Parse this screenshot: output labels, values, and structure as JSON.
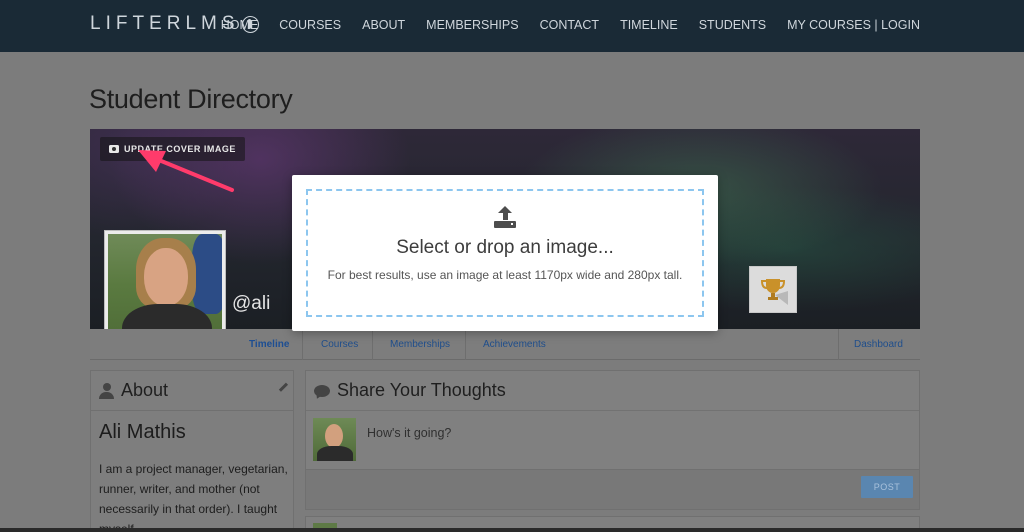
{
  "header": {
    "logo_text": "LIFTERLMS",
    "nav": [
      {
        "label": "HOME"
      },
      {
        "label": "COURSES"
      },
      {
        "label": "ABOUT"
      },
      {
        "label": "MEMBERSHIPS"
      },
      {
        "label": "CONTACT"
      },
      {
        "label": "TIMELINE"
      },
      {
        "label": "STUDENTS"
      },
      {
        "label": "MY COURSES | LOGIN"
      }
    ]
  },
  "page": {
    "title": "Student Directory"
  },
  "profile": {
    "update_cover_label": "UPDATE COVER IMAGE",
    "username": "@ali",
    "tabs": [
      {
        "label": "Timeline",
        "active": true
      },
      {
        "label": "Courses"
      },
      {
        "label": "Memberships"
      },
      {
        "label": "Achievements"
      },
      {
        "label": "Dashboard"
      }
    ]
  },
  "modal": {
    "title": "Select or drop an image...",
    "hint": "For best results, use an image at least 1170px wide and 280px tall."
  },
  "about": {
    "heading": "About",
    "name": "Ali Mathis",
    "bio": "I am a project manager, vegetarian, runner, writer, and mother (not necessarily in that order). I taught myself"
  },
  "share": {
    "heading": "Share Your Thoughts",
    "placeholder": "How's it going?",
    "post_label": "POST"
  },
  "colors": {
    "header_bg": "#1a2a36",
    "overlay": "#7c7c7c",
    "link": "#1f4e8c",
    "dropzone_border": "#8cc6ef",
    "annotation_arrow": "#ff3b6b"
  },
  "icons": [
    "logo-mark-icon",
    "camera-icon",
    "trophy-icon",
    "upload-icon",
    "user-icon",
    "pencil-icon",
    "comment-icon"
  ]
}
